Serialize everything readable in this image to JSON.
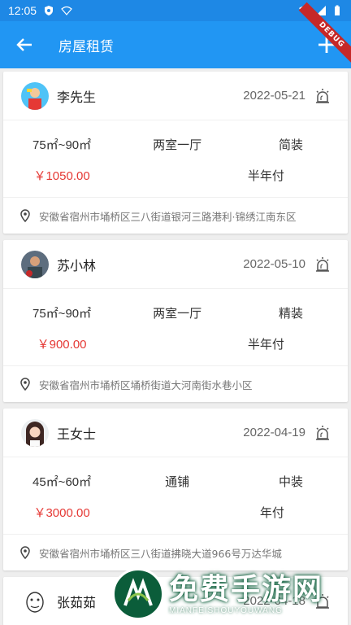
{
  "status_bar": {
    "time": "12:05"
  },
  "app_bar": {
    "title": "房屋租赁",
    "debug_label": "DEBUG"
  },
  "listings": [
    {
      "name": "李先生",
      "date": "2022-05-21",
      "area": "75㎡~90㎡",
      "layout": "两室一厅",
      "decoration": "简装",
      "price": "￥1050.00",
      "payment": "半年付",
      "address": "安徽省宿州市埇桥区三八街道银河三路港利·锦绣江南东区"
    },
    {
      "name": "苏小林",
      "date": "2022-05-10",
      "area": "75㎡~90㎡",
      "layout": "两室一厅",
      "decoration": "精装",
      "price": "￥900.00",
      "payment": "半年付",
      "address": "安徽省宿州市埇桥区埇桥街道大河南街水巷小区"
    },
    {
      "name": "王女士",
      "date": "2022-04-19",
      "area": "45㎡~60㎡",
      "layout": "通铺",
      "decoration": "中装",
      "price": "￥3000.00",
      "payment": "年付",
      "address": "安徽省宿州市埇桥区三八街道拂晓大道966号万达华城"
    },
    {
      "name": "张茹茹",
      "date": "2022-04-18"
    }
  ],
  "watermark": {
    "main": "免费手游网",
    "sub": "MIANFEISHOUYOUWANG"
  },
  "colors": {
    "app_bar": "#2196f3",
    "price": "#e53935"
  }
}
